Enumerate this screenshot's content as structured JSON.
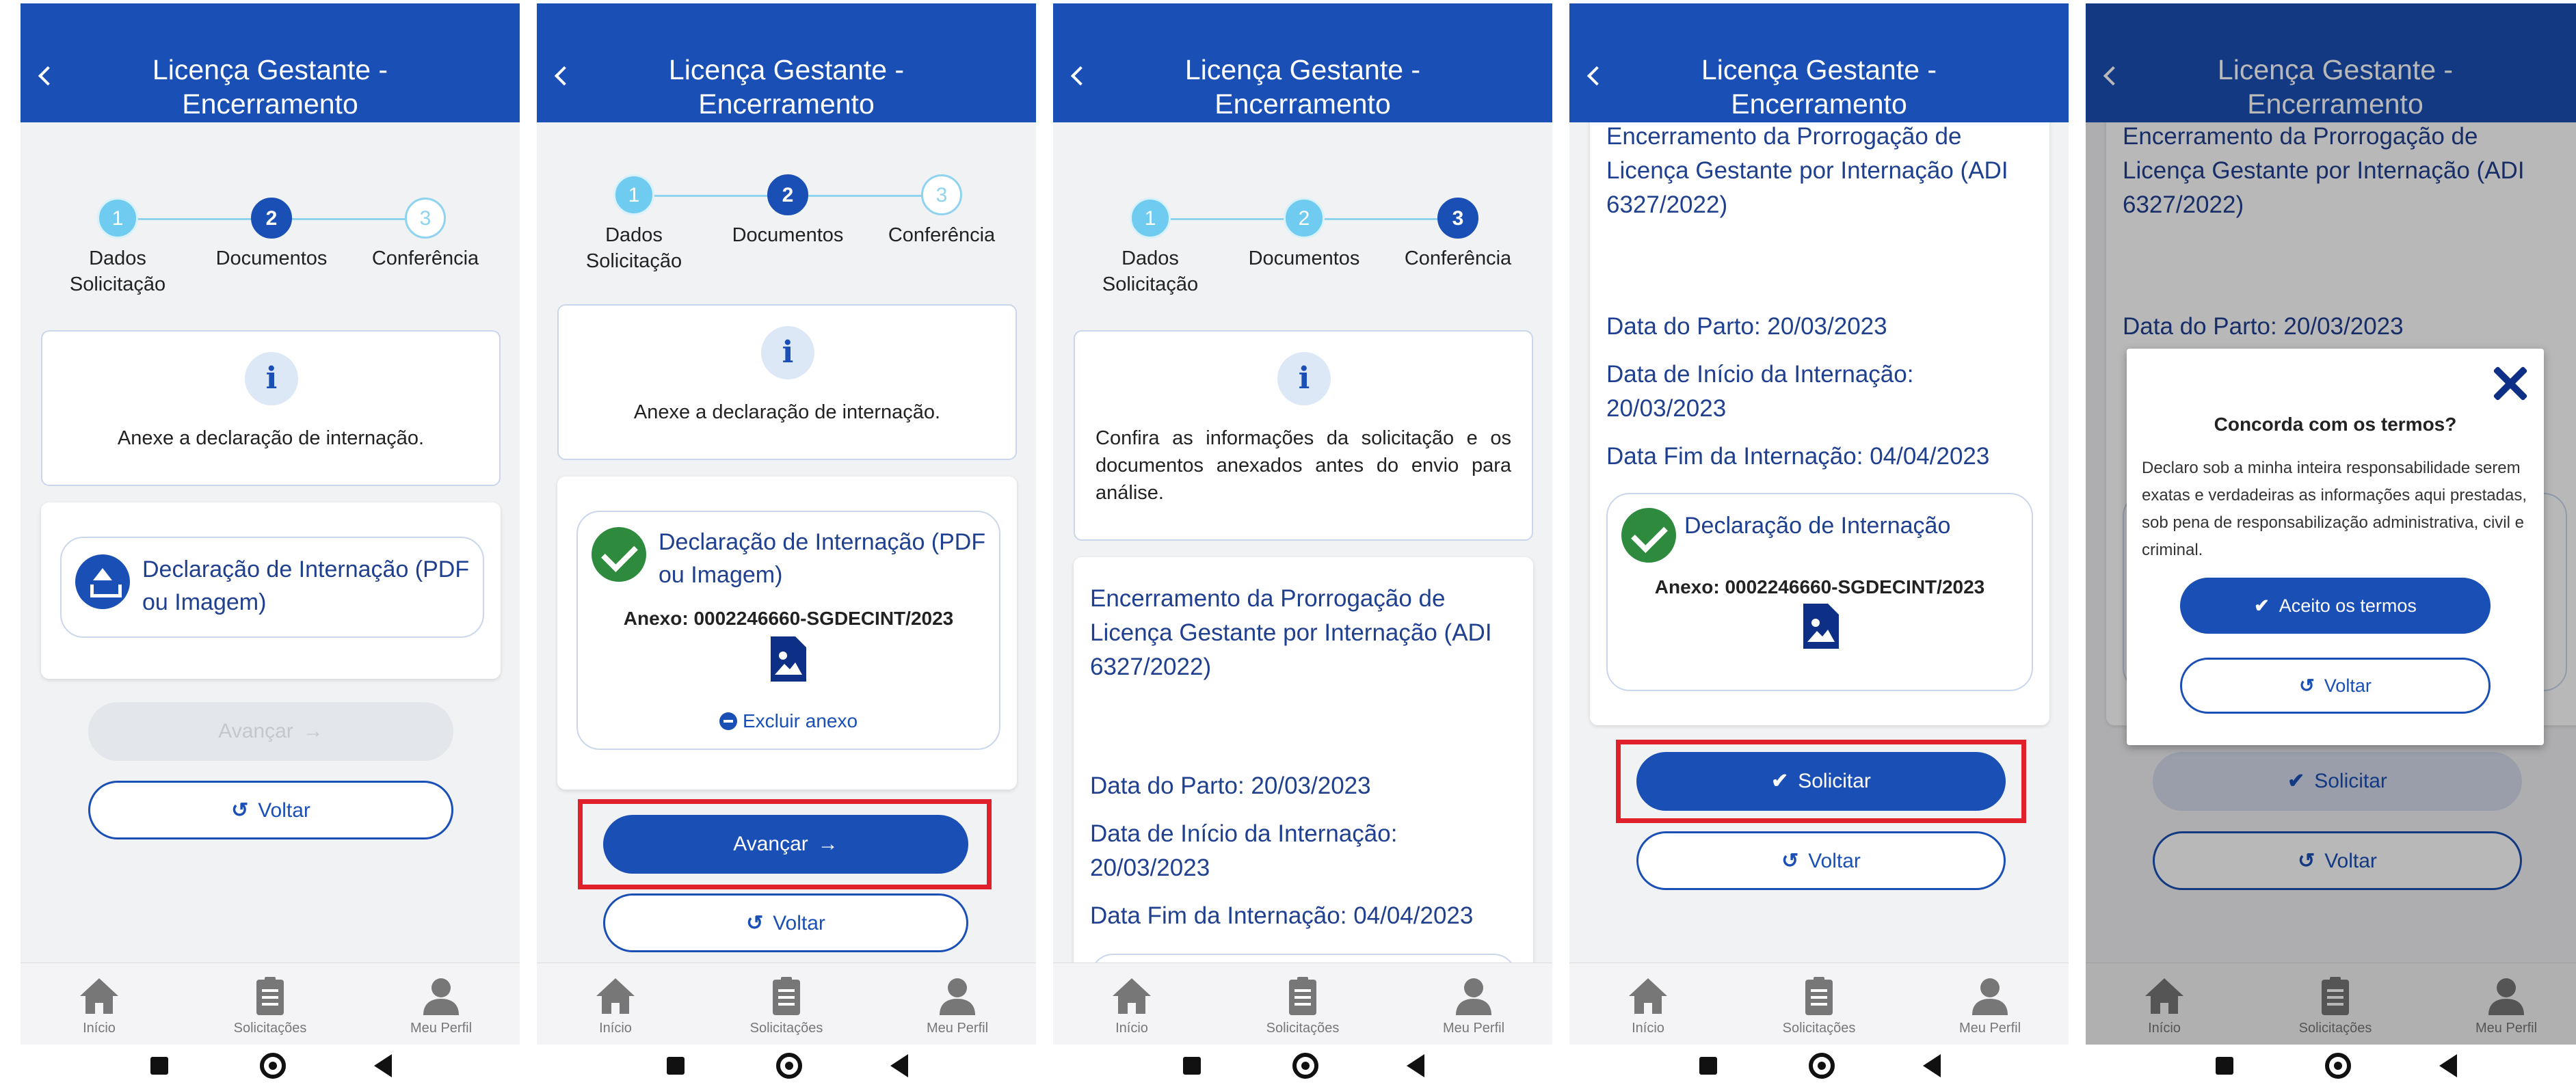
{
  "header": {
    "title": "Licença Gestante - Encerramento"
  },
  "stepper": {
    "steps": [
      {
        "number": "1",
        "label": "Dados Solicitação"
      },
      {
        "number": "2",
        "label": "Documentos"
      },
      {
        "number": "3",
        "label": "Conferência"
      }
    ]
  },
  "screen1": {
    "info_text": "Anexe a declaração de internação.",
    "doc_label": "Declaração de Internação (PDF ou Imagem)",
    "next_label": "Avançar",
    "back_label": "Voltar"
  },
  "screen2": {
    "info_text": "Anexe a declaração de internação.",
    "doc_label": "Declaração de Internação (PDF ou Imagem)",
    "annex_text": "Anexo: 0002246660-SGDECINT/2023",
    "remove_label": "Excluir anexo",
    "next_label": "Avançar",
    "back_label": "Voltar"
  },
  "screen3": {
    "info_text": "Confira as informações da solicitação e os documentos anexados antes do envio para análise.",
    "request_title": "Encerramento da Prorrogação de Licença Gestante por Internação (ADI 6327/2022)",
    "birth_date": "Data do Parto: 20/03/2023",
    "start_date": "Data de Início da Internação: 20/03/2023",
    "end_date": "Data Fim da Internação: 04/04/2023"
  },
  "screen4": {
    "request_title": "Encerramento da Prorrogação de Licença Gestante por Internação (ADI 6327/2022)",
    "birth_date": "Data do Parto: 20/03/2023",
    "start_date": "Data de Início da Internação: 20/03/2023",
    "end_date": "Data Fim da Internação: 04/04/2023",
    "doc_label": "Declaração de Internação",
    "annex_text": "Anexo: 0002246660-SGDECINT/2023",
    "submit_label": "Solicitar",
    "back_label": "Voltar"
  },
  "screen5": {
    "request_title": "Encerramento da Prorrogação de Licença Gestante por Internação (ADI 6327/2022)",
    "birth_date": "Data do Parto: 20/03/2023",
    "submit_label": "Solicitar",
    "back_label": "Voltar",
    "modal": {
      "title": "Concorda com os termos?",
      "text": "Declaro sob a minha inteira responsabilidade serem exatas e verdadeiras as informações aqui prestadas, sob pena de responsabilização administrativa, civil e criminal.",
      "accept_label": "Aceito os termos",
      "back_label": "Voltar"
    }
  },
  "bottom_nav": {
    "items": [
      {
        "label": "Início",
        "icon": "home-icon"
      },
      {
        "label": "Solicitações",
        "icon": "clipboard-icon"
      },
      {
        "label": "Meu Perfil",
        "icon": "user-icon"
      }
    ]
  },
  "colors": {
    "brand_blue": "#1a4fb5",
    "highlight_red": "#e0202a",
    "success_green": "#2e8b3e",
    "step_done": "#6fcbef"
  }
}
